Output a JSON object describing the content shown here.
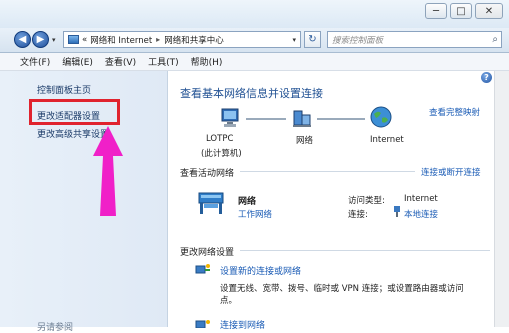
{
  "titlebar": {
    "minimize_glyph": "─",
    "maximize_glyph": "□",
    "close_glyph": "✕"
  },
  "nav": {
    "back_glyph": "◀",
    "forward_glyph": "▶",
    "path_prefix": "«",
    "crumb1": "网络和 Internet",
    "separator": "▸",
    "crumb2": "网络和共享中心",
    "dropdown_glyph": "▾",
    "refresh_glyph": "↻",
    "search_placeholder": "搜索控制面板"
  },
  "menu": {
    "items": [
      "文件(F)",
      "编辑(E)",
      "查看(V)",
      "工具(T)",
      "帮助(H)"
    ]
  },
  "sidebar": {
    "home": "控制面板主页",
    "adapter_settings": "更改适配器设置",
    "advanced_sharing": "更改高级共享设置",
    "see_also": "另请参阅"
  },
  "main": {
    "title": "查看基本网络信息并设置连接",
    "view_full_map": "查看完整映射",
    "map": {
      "computer_name": "LOTPC",
      "computer_sub": "(此计算机)",
      "network": "网络",
      "internet": "Internet"
    },
    "active_networks_title": "查看活动网络",
    "connect_disconnect": "连接或断开连接",
    "network": {
      "name": "网络",
      "type": "工作网络",
      "access_label": "访问类型:",
      "access_value": "Internet",
      "connection_label": "连接:",
      "connection_value": "本地连接"
    },
    "change_settings_title": "更改网络设置",
    "setup_link": "设置新的连接或网络",
    "setup_desc_line1": "设置无线、宽带、拨号、临时或 VPN 连接；或设置路由器或访问",
    "setup_desc_line2": "点。",
    "connect_to_network": "连接到网络"
  },
  "colors": {
    "highlight_box": "#e0232e",
    "arrow": "#f020c8",
    "link": "#1a5bb5",
    "title": "#1e4f92"
  }
}
